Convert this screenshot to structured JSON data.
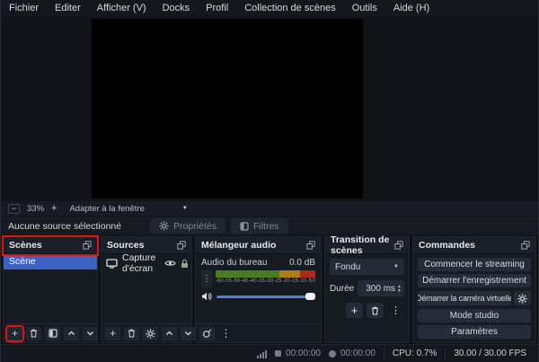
{
  "menu": {
    "items": [
      "Fichier",
      "Editer",
      "Afficher (V)",
      "Docks",
      "Profil",
      "Collection de scènes",
      "Outils",
      "Aide (H)"
    ]
  },
  "preview": {
    "zoom_out_label": "−",
    "zoom_level": "33%",
    "zoom_in_label": "+",
    "fit_label": "Adapter à la fenêtre"
  },
  "source_bar": {
    "status": "Aucune source sélectionné",
    "properties_label": "Propriétés",
    "filters_label": "Filtres"
  },
  "scenes_panel": {
    "title": "Scènes",
    "items": [
      "Scène"
    ]
  },
  "sources_panel": {
    "title": "Sources",
    "items": [
      "Capture d'écran"
    ]
  },
  "mixer_panel": {
    "title": "Mélangeur audio",
    "channel_name": "Audio du bureau",
    "channel_level": "0.0 dB",
    "ticks": [
      "-60",
      "-55",
      "-50",
      "-45",
      "-40",
      "-35",
      "-30",
      "-25",
      "-20",
      "-15",
      "-10",
      "-5",
      "0"
    ]
  },
  "transition_panel": {
    "title": "Transition de scènes",
    "selected_transition": "Fondu",
    "duration_label": "Durée",
    "duration_value": "300 ms"
  },
  "controls_panel": {
    "title": "Commandes",
    "start_streaming": "Commencer le streaming",
    "start_recording": "Démarrer l'enregistrement",
    "start_virtual_camera": "Démarrer la caméra virtuelle",
    "studio_mode": "Mode studio",
    "settings": "Paramètres"
  },
  "status_bar": {
    "stream_time": "00:00:00",
    "record_time": "00:00:00",
    "cpu": "CPU: 0.7%",
    "fps": "30.00 / 30.00 FPS"
  },
  "colors": {
    "selection_blue": "#3a63c4",
    "highlight_red": "#e11212",
    "meter_green": "#4a7c20",
    "meter_orange": "#ab7e1d",
    "meter_red": "#b1251d",
    "volume_slider_blue": "#4a7fd6"
  }
}
